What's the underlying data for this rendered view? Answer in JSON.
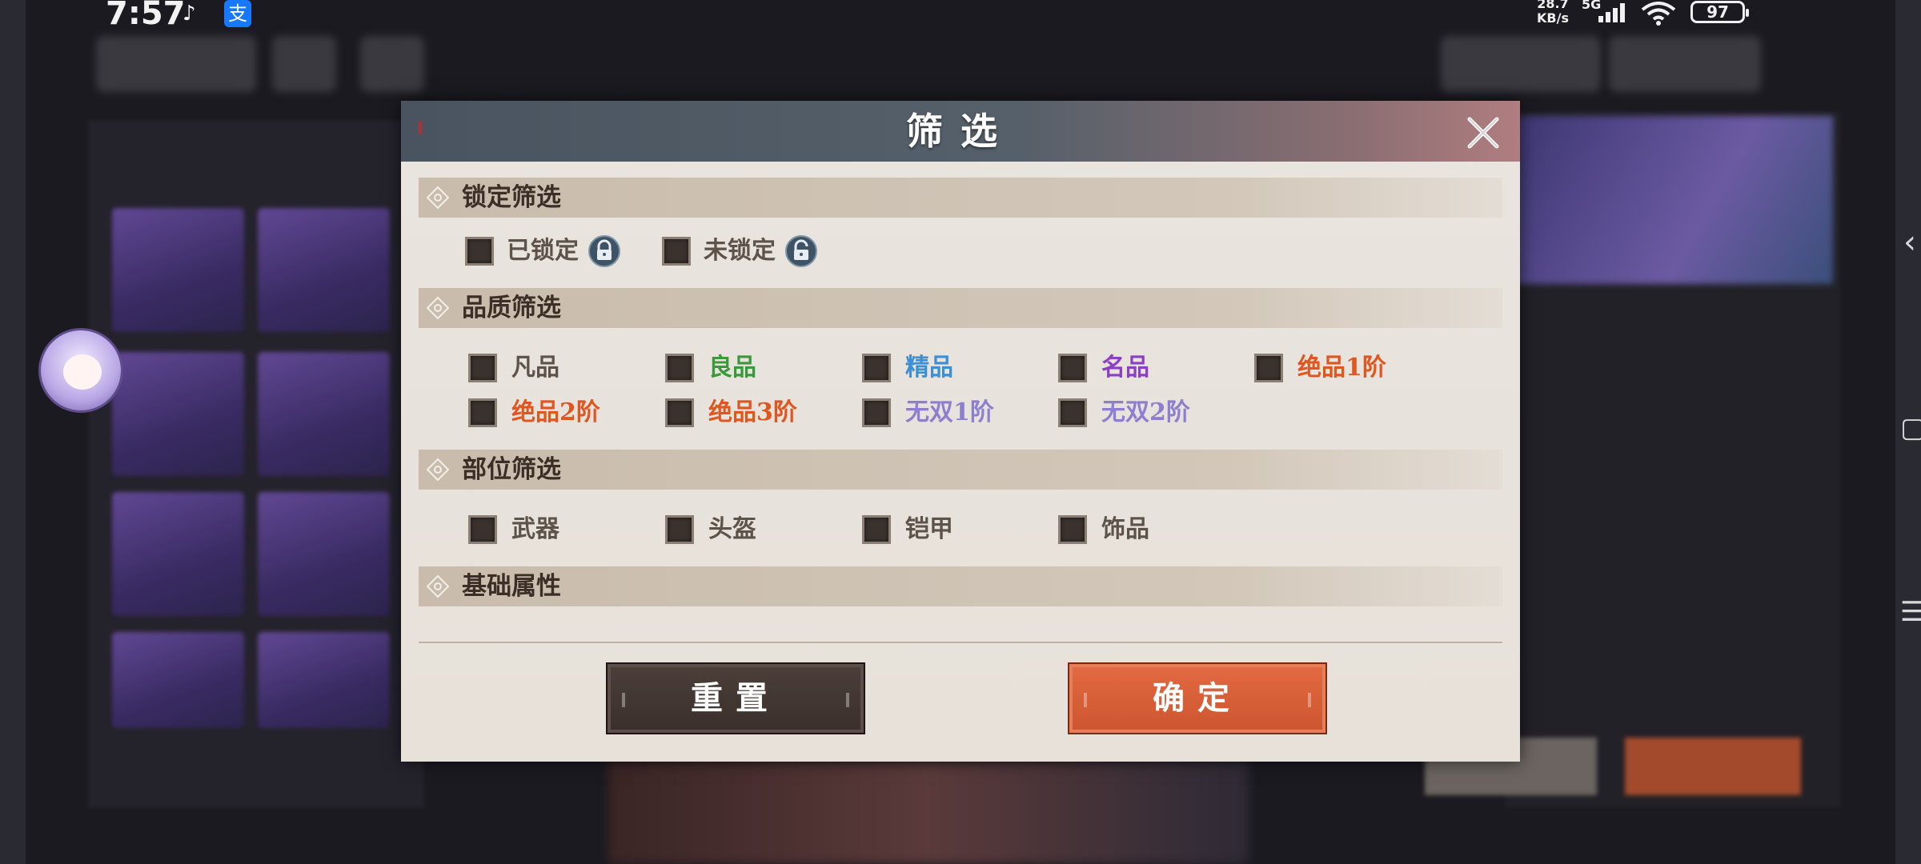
{
  "status_bar": {
    "time": "7:57",
    "net_speed": "28.7",
    "net_unit": "KB/s",
    "network_type": "5G",
    "battery": "97",
    "app_icon_1": "tiktok-icon",
    "app_icon_2": "支"
  },
  "dialog": {
    "title": "筛选",
    "close_icon": "close-icon",
    "sections": {
      "lock": {
        "title": "锁定筛选",
        "options": [
          {
            "label": "已锁定",
            "color": "#5d534b",
            "icon": "locked-icon"
          },
          {
            "label": "未锁定",
            "color": "#5d534b",
            "icon": "unlocked-icon"
          }
        ]
      },
      "quality": {
        "title": "品质筛选",
        "options": [
          {
            "label": "凡品",
            "color": "#5d534b"
          },
          {
            "label": "良品",
            "color": "#3a9a3a"
          },
          {
            "label": "精品",
            "color": "#3a8fd6"
          },
          {
            "label": "名品",
            "color": "#8b3fc4"
          },
          {
            "label": "绝品1阶",
            "color": "#e0561f"
          },
          {
            "label": "绝品2阶",
            "color": "#e0561f"
          },
          {
            "label": "绝品3阶",
            "color": "#e0561f"
          },
          {
            "label": "无双1阶",
            "color": "#8d7fd0"
          },
          {
            "label": "无双2阶",
            "color": "#8d7fd0"
          }
        ]
      },
      "slot": {
        "title": "部位筛选",
        "options": [
          {
            "label": "武器",
            "color": "#5d534b"
          },
          {
            "label": "头盔",
            "color": "#5d534b"
          },
          {
            "label": "铠甲",
            "color": "#5d534b"
          },
          {
            "label": "饰品",
            "color": "#5d534b"
          }
        ]
      },
      "base_attr": {
        "title": "基础属性"
      }
    },
    "buttons": {
      "reset": "重置",
      "confirm": "确定"
    }
  },
  "colors": {
    "header_left": "#4a5460",
    "header_right": "#b07d80",
    "confirm_button": "#d95c34",
    "reset_button": "#43372f",
    "panel_bg": "#e8e2dc"
  }
}
